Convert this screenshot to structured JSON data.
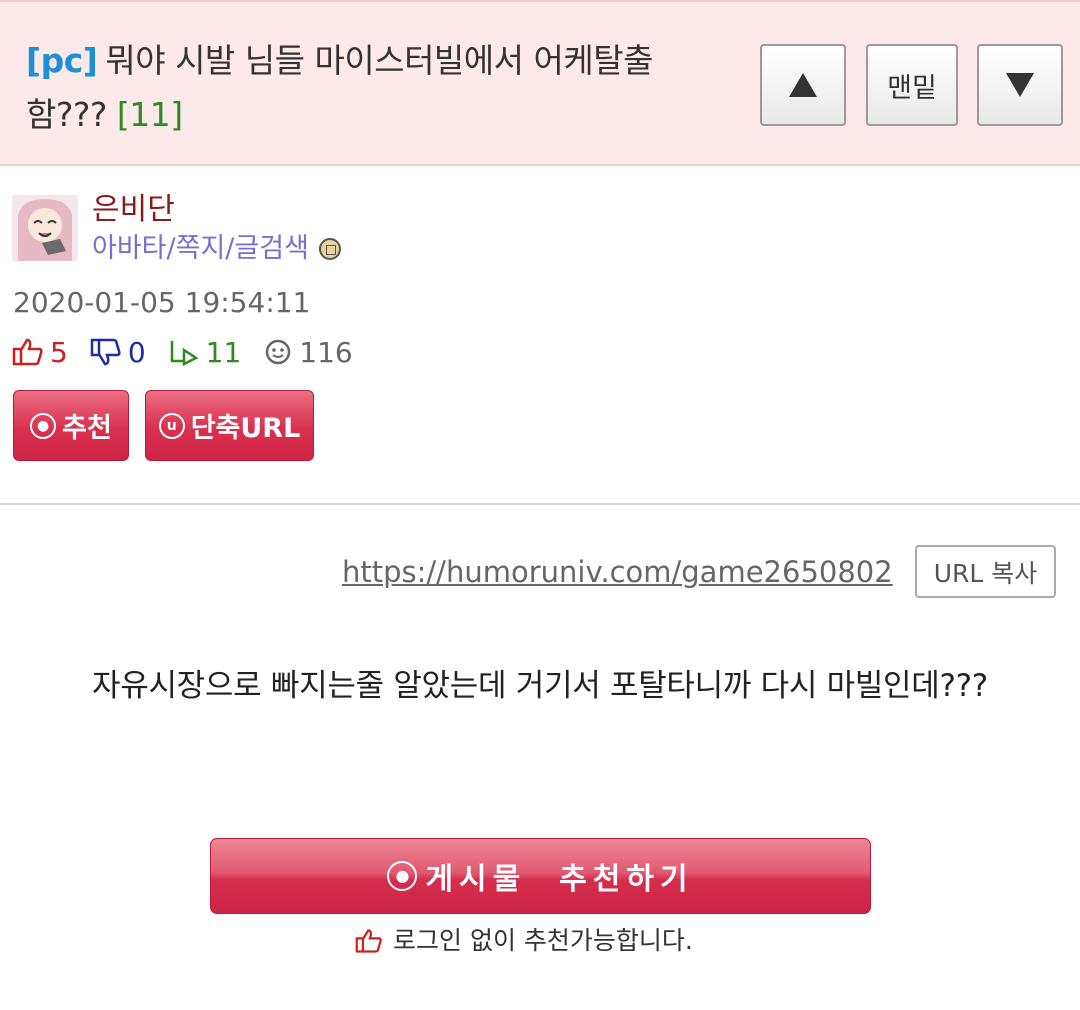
{
  "header": {
    "tag": "[pc]",
    "title": "뭐야 시발 님들 마이스터빌에서 어케탈출함???",
    "comment_count": "[11]",
    "nav_bottom_label": "맨밑"
  },
  "author": {
    "name": "은비단",
    "links": "아바타/쪽지/글검색"
  },
  "post": {
    "datetime": "2020-01-05 19:54:11",
    "stats": {
      "up": "5",
      "down": "0",
      "reply": "11",
      "views": "116"
    },
    "recommend_label": "추천",
    "short_url_label": "단축URL",
    "url": "https://humoruniv.com/game2650802",
    "url_copy_label": "URL 복사",
    "content": "자유시장으로 빠지는줄 알았는데 거기서 포탈타니까 다시 마빌인데???",
    "recommend_big_label": "게시물  추천하기",
    "recommend_note": "로그인 없이 추천가능합니다."
  },
  "colors": {
    "header_bg": "#fde9e9",
    "tag": "#1d8fd8",
    "accent_red": "#d8304e",
    "comment_green": "#2f8a1d"
  }
}
